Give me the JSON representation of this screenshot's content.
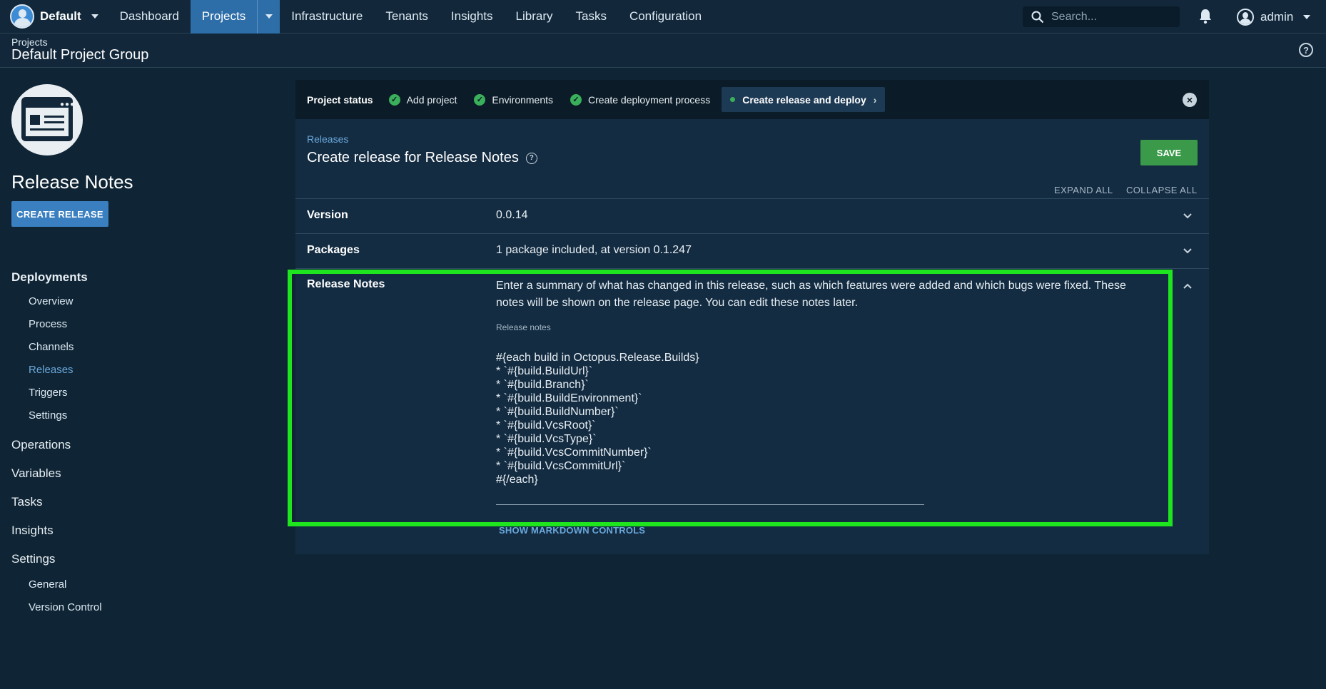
{
  "topnav": {
    "space_name": "Default",
    "items": [
      "Dashboard",
      "Projects",
      "Infrastructure",
      "Tenants",
      "Insights",
      "Library",
      "Tasks",
      "Configuration"
    ],
    "active_item": "Projects",
    "search_placeholder": "Search...",
    "user_name": "admin"
  },
  "pagehead": {
    "breadcrumb": "Projects",
    "group_title": "Default Project Group"
  },
  "sidebar": {
    "project_title": "Release Notes",
    "create_release_label": "CREATE RELEASE",
    "deployments_heading": "Deployments",
    "deployments_items": [
      "Overview",
      "Process",
      "Channels",
      "Releases",
      "Triggers",
      "Settings"
    ],
    "active_item": "Releases",
    "operations": "Operations",
    "variables": "Variables",
    "tasks": "Tasks",
    "insights": "Insights",
    "settings_heading": "Settings",
    "settings_items": [
      "General",
      "Version Control"
    ]
  },
  "status_bar": {
    "label": "Project status",
    "steps": [
      "Add project",
      "Environments",
      "Create deployment process"
    ],
    "active_step": "Create release and deploy"
  },
  "form": {
    "breadcrumb_link": "Releases",
    "title": "Create release for Release Notes",
    "save_label": "SAVE",
    "expand_all": "EXPAND ALL",
    "collapse_all": "COLLAPSE ALL",
    "version": {
      "label": "Version",
      "value": "0.0.14"
    },
    "packages": {
      "label": "Packages",
      "value": "1 package included, at version 0.1.247"
    },
    "release_notes": {
      "label": "Release Notes",
      "description": "Enter a summary of what has changed in this release, such as which features were added and which bugs were fixed. These notes will be shown on the release page. You can edit these notes later.",
      "field_label": "Release notes",
      "lines": [
        "#{each build in Octopus.Release.Builds}",
        "* `#{build.BuildUrl}`",
        "* `#{build.Branch}`",
        "* `#{build.BuildEnvironment}`",
        "* `#{build.BuildNumber}`",
        "* `#{build.VcsRoot}`",
        "* `#{build.VcsType}`",
        "* `#{build.VcsCommitNumber}`",
        "* `#{build.VcsCommitUrl}`",
        "#{/each}"
      ],
      "markdown_link": "SHOW MARKDOWN CONTROLS"
    }
  },
  "colors": {
    "accent": "#2e6ea8",
    "link": "#6aa8dc",
    "save": "#3a9a4a",
    "highlight": "#1fe51f",
    "success": "#3ab05b"
  }
}
